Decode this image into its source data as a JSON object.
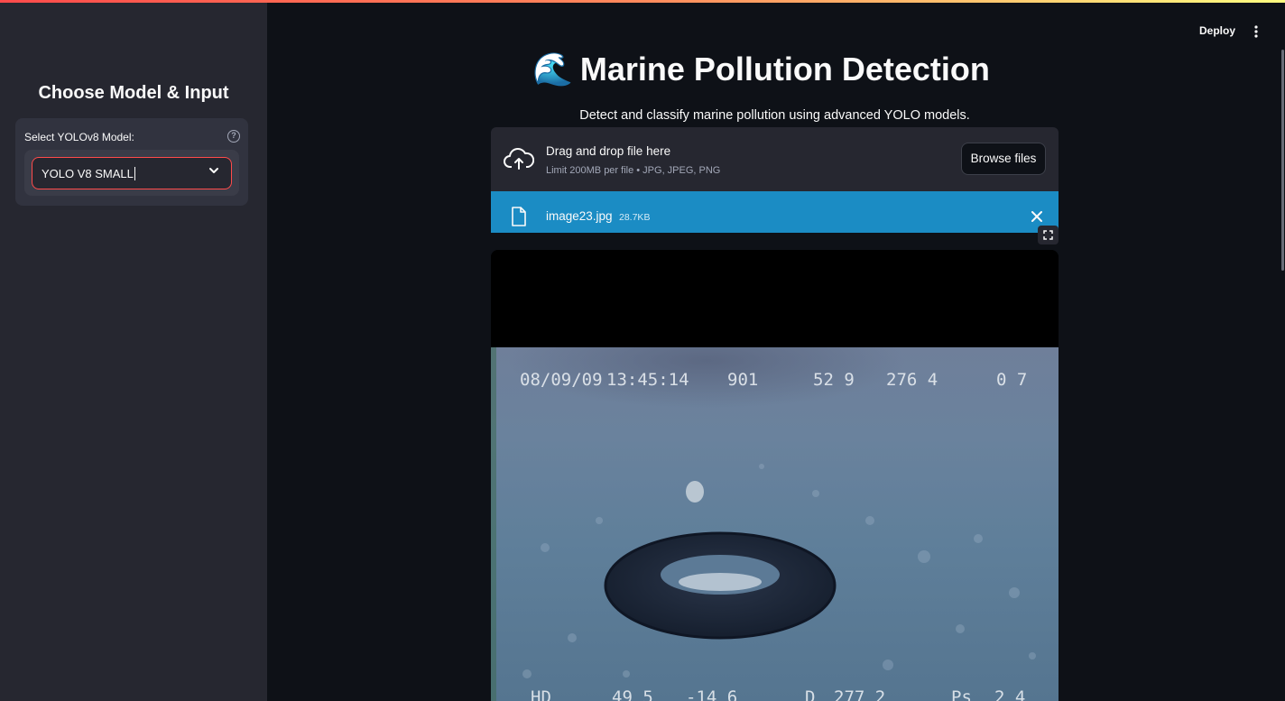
{
  "app": {
    "deploy_label": "Deploy",
    "menu_icon": "kebab-menu-icon",
    "accent_color": "#ff4b4b"
  },
  "sidebar": {
    "title": "Choose Model & Input",
    "model_select": {
      "label": "Select YOLOv8 Model:",
      "value": "YOLO V8 SMALL",
      "help_icon": "?"
    }
  },
  "main": {
    "title": "Marine Pollution Detection",
    "title_icon": "🌊",
    "subtitle": "Detect and classify marine pollution using advanced YOLO models.",
    "uploader": {
      "title": "Drag and drop file here",
      "limit": "Limit 200MB per file • JPG, JPEG, PNG",
      "browse_label": "Browse files"
    },
    "uploaded_file": {
      "name": "image23.jpg",
      "size": "28.7KB",
      "highlight_color": "#1b8cc4"
    },
    "image_overlay": {
      "top_row": [
        "08/09/09",
        "13:45:14",
        "901",
        "52 9",
        "276 4",
        "0 7"
      ],
      "bottom_row": [
        "HD",
        "49 5",
        "-14 6",
        "D",
        "277 2",
        "Ps",
        "2 4"
      ]
    }
  }
}
